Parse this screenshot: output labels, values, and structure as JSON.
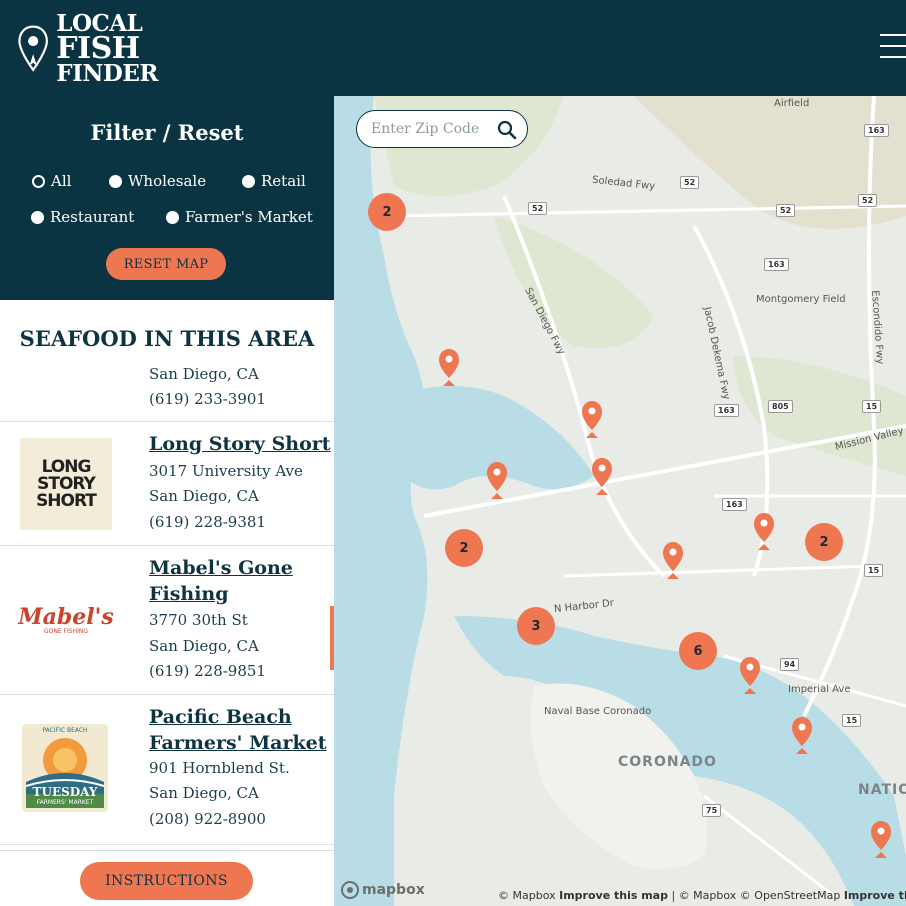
{
  "header": {
    "logo_lines": [
      "LOCAL",
      "FISH",
      "FINDER"
    ]
  },
  "filter": {
    "title": "Filter / Reset",
    "options": [
      "All",
      "Wholesale",
      "Retail",
      "Restaurant",
      "Farmer's Market"
    ],
    "selected": "All",
    "reset_label": "RESET MAP"
  },
  "list": {
    "heading": "SEAFOOD IN THIS AREA",
    "partial_entry": {
      "city": "San Diego, CA",
      "phone": "(619) 233-3901"
    },
    "entries": [
      {
        "name": "Long Story Short",
        "address": "3017 University Ave",
        "city": "San Diego, CA",
        "phone": "(619) 228-9381",
        "logo_text": [
          "LONG",
          "STORY",
          "SHORT"
        ]
      },
      {
        "name": "Mabel's Gone Fishing",
        "name_lines": [
          "Mabel's Gone",
          "Fishing"
        ],
        "address": "3770 30th St",
        "city": "San Diego, CA",
        "phone": "(619) 228-9851",
        "logo_text": [
          "Mabel's",
          "GONE FISHING"
        ]
      },
      {
        "name": "Pacific Beach Farmers' Market",
        "name_lines": [
          "Pacific Beach",
          "Farmers' Market"
        ],
        "address": "901 Hornblend St.",
        "city": "San Diego, CA",
        "phone": "(208) 922-8900",
        "logo_text": [
          "PACIFIC BEACH",
          "TUESDAY",
          "FARMERS' MARKET"
        ]
      }
    ]
  },
  "footer": {
    "instructions_label": "INSTRUCTIONS"
  },
  "map": {
    "zip_placeholder": "Enter Zip Code",
    "clusters": [
      "2",
      "2",
      "2",
      "3",
      "6"
    ],
    "labels": [
      "Airfield",
      "Soledad Fwy",
      "Montgomery Field",
      "Jacob Dekema Fwy",
      "San Diego Fwy",
      "Escondido Fwy",
      "Mission Valley Fwy",
      "N Harbor Dr",
      "Imperial Ave",
      "Naval Base Coronado",
      "CORONADO",
      "NATIO"
    ],
    "highway_shields": [
      "163",
      "52",
      "52",
      "52",
      "52",
      "163",
      "163",
      "805",
      "15",
      "163",
      "15",
      "94",
      "15",
      "75"
    ],
    "logo": "mapbox",
    "attribution": [
      "© Mapbox",
      "Improve this map",
      "© Mapbox",
      "© OpenStreetMap",
      "Improve this m"
    ]
  },
  "colors": {
    "navy": "#0b3442",
    "accent": "#ee7651",
    "map_bg": "#e9ebe6",
    "water": "#b9dde6"
  }
}
